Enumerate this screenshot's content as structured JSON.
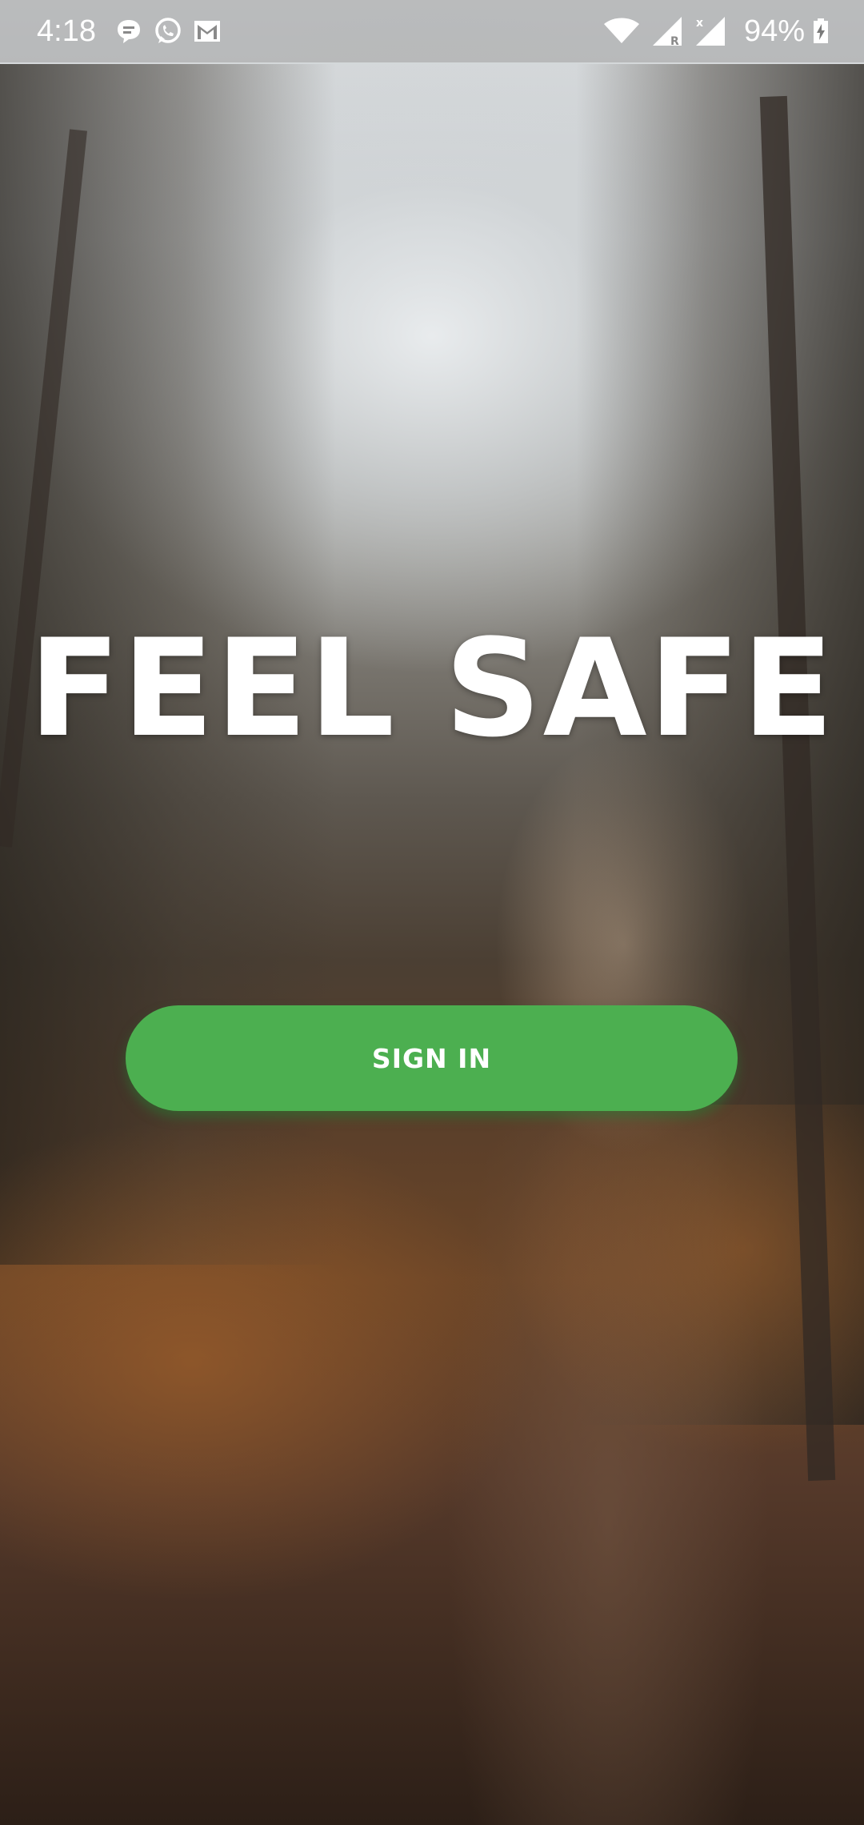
{
  "status_bar": {
    "time": "4:18",
    "notification_icons": [
      "message-icon",
      "whatsapp-icon",
      "gmail-icon"
    ],
    "system_icons": [
      "wifi-icon",
      "signal-roaming-icon",
      "signal-icon",
      "battery-charging-icon"
    ],
    "battery_percent": "94%"
  },
  "headline": {
    "text": "FEEL SAFE"
  },
  "signin": {
    "label": "SIGN IN"
  },
  "colors": {
    "button_green": "#4caf50",
    "text_white": "#ffffff"
  }
}
